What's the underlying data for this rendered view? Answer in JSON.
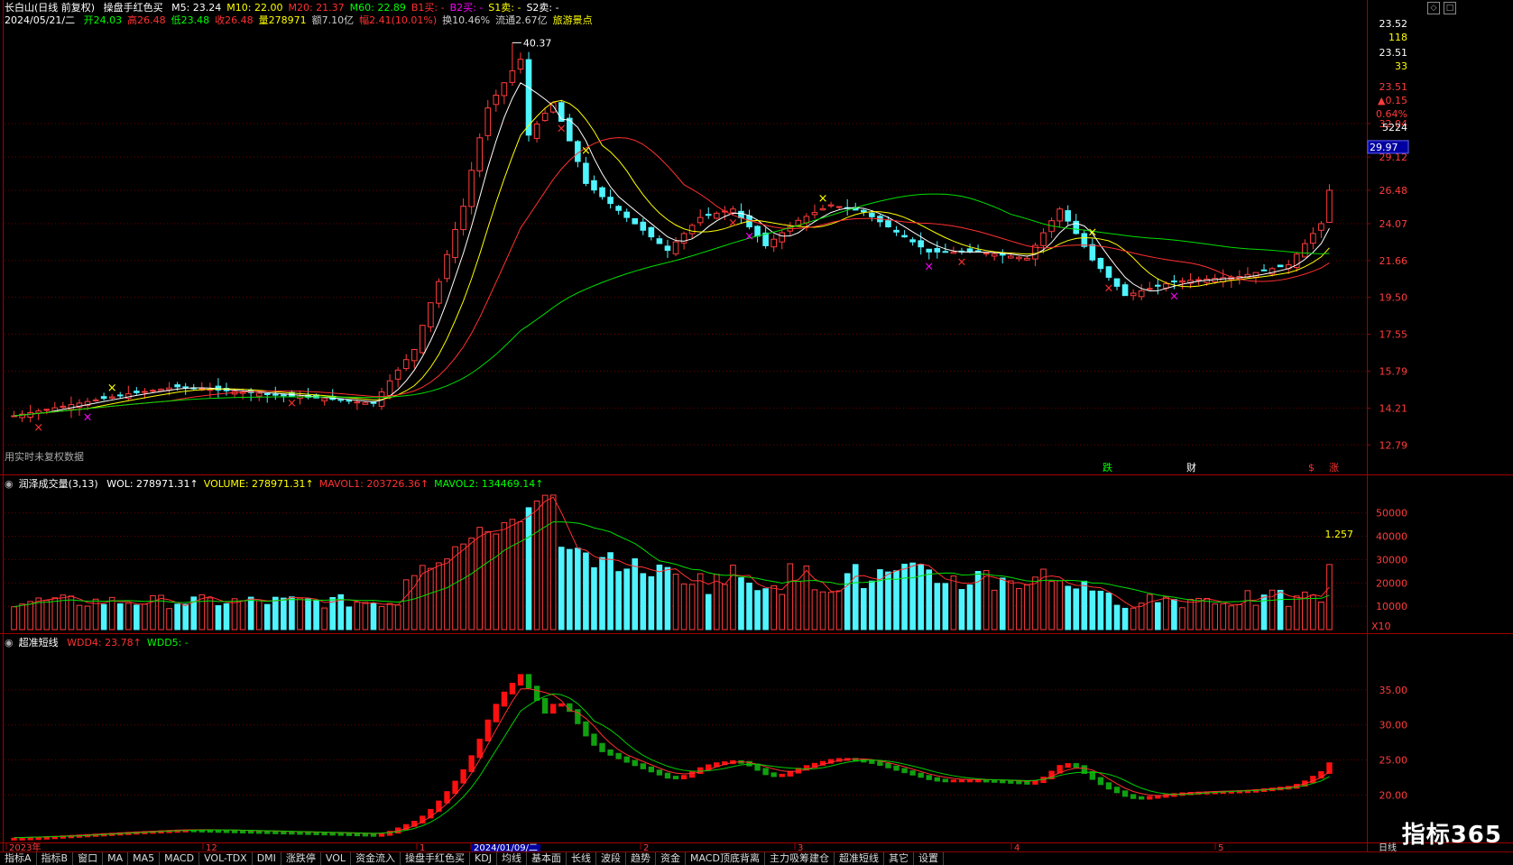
{
  "title_line": {
    "name": "长白山(日线 前复权)",
    "indicator": "操盘手红色买",
    "items": [
      {
        "label": "M5: 23.24",
        "color": "#ffffff"
      },
      {
        "label": "M10: 22.00",
        "color": "#ffff00"
      },
      {
        "label": "M20: 21.37",
        "color": "#ff3030"
      },
      {
        "label": "M60: 22.89",
        "color": "#00ff00"
      },
      {
        "label": "B1买: -",
        "color": "#ff3030"
      },
      {
        "label": "B2买: -",
        "color": "#ff00ff"
      },
      {
        "label": "S1卖: -",
        "color": "#ffff00"
      },
      {
        "label": "S2卖: -",
        "color": "#ffffff"
      }
    ]
  },
  "quote_line": {
    "date": "2024/05/21/二",
    "items": [
      {
        "label": "开24.03",
        "color": "#00ff00"
      },
      {
        "label": "高26.48",
        "color": "#ff3030"
      },
      {
        "label": "低23.48",
        "color": "#00ff00"
      },
      {
        "label": "收26.48",
        "color": "#ff3030"
      },
      {
        "label": "量278971",
        "color": "#ffff00"
      },
      {
        "label": "额7.10亿",
        "color": "#cccccc"
      },
      {
        "label": "幅2.41(10.01%)",
        "color": "#ff3030"
      },
      {
        "label": "换10.46%",
        "color": "#cccccc"
      },
      {
        "label": "流通2.67亿",
        "color": "#cccccc"
      },
      {
        "label": "旅游景点",
        "color": "#ffff00"
      }
    ]
  },
  "peak_label": "40.37",
  "left_annotation": "用实时未复权数据",
  "price_axis": [
    "32.04",
    "29.12",
    "26.48",
    "24.07",
    "21.66",
    "19.50",
    "17.55",
    "15.79",
    "14.21",
    "12.79"
  ],
  "current_price_tag": "29.97",
  "top_right_box": [
    "23.52",
    "118",
    "23.51",
    "33",
    "23.51",
    "▲0.15",
    "0.64%",
    "5224"
  ],
  "event_markers": [
    {
      "label": "跌",
      "color": "#00ff00"
    },
    {
      "label": "财",
      "color": "#ffffff"
    },
    {
      "label": "$",
      "color": "#ff3030"
    },
    {
      "label": "涨",
      "color": "#ff3030"
    }
  ],
  "vol_line": {
    "name": "润泽成交量(3,13)",
    "items": [
      {
        "label": "WOL: 278971.31↑",
        "color": "#ffffff"
      },
      {
        "label": "VOLUME: 278971.31↑",
        "color": "#ffff00"
      },
      {
        "label": "MAVOL1: 203726.36↑",
        "color": "#ff3030"
      },
      {
        "label": "MAVOL2: 134469.14↑",
        "color": "#00ff00"
      }
    ]
  },
  "vol_axis": [
    "50000",
    "40000",
    "30000",
    "20000",
    "10000"
  ],
  "vol_mult": "X10",
  "vol_side_value": "1.257",
  "short_line": {
    "name": "超准短线",
    "items": [
      {
        "label": "WDD4: 23.78↑",
        "color": "#ff3030"
      },
      {
        "label": "WDD5: -",
        "color": "#00ff00"
      }
    ]
  },
  "short_axis": [
    "35.00",
    "30.00",
    "25.00",
    "20.00"
  ],
  "time_axis": [
    "2023年",
    "12",
    "1",
    "2024/01/09/二",
    "2",
    "3",
    "4",
    "5"
  ],
  "period_label": "日线",
  "logo_text": "指标365",
  "tabs": [
    "指标A",
    "指标B",
    "窗口",
    "MA",
    "MA5",
    "MACD",
    "VOL-TDX",
    "DMI",
    "涨跌停",
    "VOL",
    "资金流入",
    "操盘手红色买",
    "KDJ",
    "均线",
    "基本面",
    "长线",
    "波段",
    "趋势",
    "资金",
    "MACD顶底背离",
    "主力吸筹建仓",
    "超准短线",
    "其它",
    "设置"
  ],
  "chart_data": {
    "type": "candlestick",
    "title": "长白山(日线 前复权)",
    "xlabel": "",
    "ylabel": "",
    "ylim": [
      12.79,
      42.0
    ],
    "x_ticks": [
      "2023年",
      "12",
      "1",
      "2024/01/09/二",
      "2",
      "3",
      "4",
      "5"
    ],
    "close_anchors": [
      {
        "x": "2023-11-10",
        "close": 13.9
      },
      {
        "x": "2023-12-01",
        "close": 15.1
      },
      {
        "x": "2023-12-29",
        "close": 14.6
      },
      {
        "x": "2024-01-09",
        "close": 19.0
      },
      {
        "x": "2024-01-18",
        "close": 36.0
      },
      {
        "x": "2024-01-23",
        "close": 38.5
      },
      {
        "x": "2024-02-05",
        "close": 27.0
      },
      {
        "x": "2024-02-23",
        "close": 22.3
      },
      {
        "x": "2024-03-04",
        "close": 24.5
      },
      {
        "x": "2024-03-15",
        "close": 25.0
      },
      {
        "x": "2024-04-08",
        "close": 21.8
      },
      {
        "x": "2024-04-22",
        "close": 20.1
      },
      {
        "x": "2024-05-20",
        "close": 24.07
      },
      {
        "x": "2024-05-21",
        "close": 26.48
      }
    ],
    "series": [
      {
        "name": "M5",
        "last": 23.24
      },
      {
        "name": "M10",
        "last": 22.0
      },
      {
        "name": "M20",
        "last": 21.37
      },
      {
        "name": "M60",
        "last": 22.89
      }
    ],
    "volume_last": 278971.31,
    "mavol1_last": 203726.36,
    "mavol2_last": 134469.14,
    "wdd4_last": 23.78
  }
}
